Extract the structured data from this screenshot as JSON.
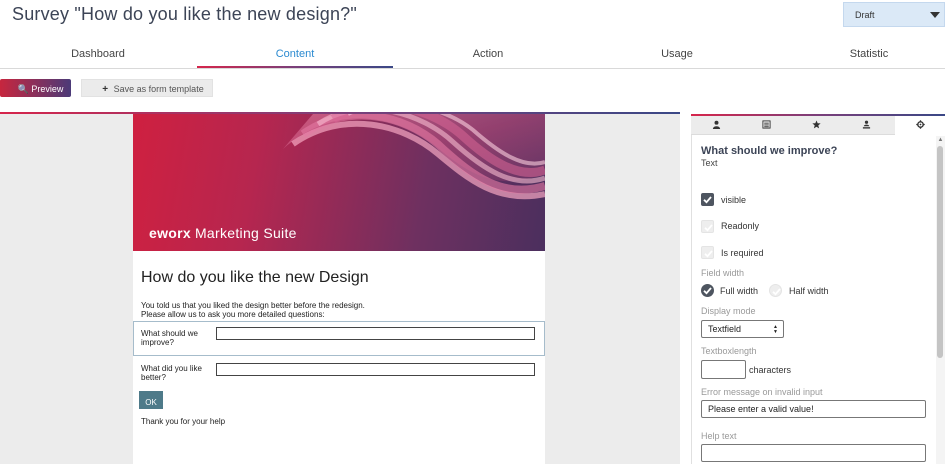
{
  "header": {
    "title": "Survey \"How do you like the new design?\"",
    "status": "Draft"
  },
  "tabs": [
    {
      "label": "Dashboard"
    },
    {
      "label": "Content"
    },
    {
      "label": "Action"
    },
    {
      "label": "Usage"
    },
    {
      "label": "Statistic"
    }
  ],
  "toolbar": {
    "preview_label": "Preview",
    "template_label": "Save as form template"
  },
  "form": {
    "brand_bold": "eworx",
    "brand_rest": "Marketing Suite",
    "heading": "How do you like the new Design",
    "intro_line1": "You told us that you liked the design better before the redesign.",
    "intro_line2": "Please allow us to ask you more detailed questions:",
    "questions": [
      {
        "label": "What should we improve?"
      },
      {
        "label": "What did you like better?"
      }
    ],
    "ok_label": "OK",
    "thanks": "Thank you for your help"
  },
  "panel": {
    "tabs": [
      {
        "icon": "person-icon"
      },
      {
        "icon": "list-icon"
      },
      {
        "icon": "star-icon"
      },
      {
        "icon": "user-download-icon"
      },
      {
        "icon": "gear-icon"
      }
    ],
    "field_title": "What should we improve?",
    "field_type": "Text",
    "visible_label": "visible",
    "readonly_label": "Readonly",
    "required_label": "Is required",
    "field_width_label": "Field width",
    "full_width_label": "Full width",
    "half_width_label": "Half width",
    "display_mode_label": "Display mode",
    "display_mode_value": "Textfield",
    "textboxlength_label": "Textboxlength",
    "textboxlength_value": "",
    "characters_label": "characters",
    "error_label": "Error message on invalid input",
    "error_value": "Please enter a valid value!",
    "help_label": "Help text",
    "help_value": ""
  },
  "colors": {
    "accent_blue": "#2b8ad0",
    "brand_red": "#d6254b",
    "brand_purple": "#3a4886",
    "ok_button": "#4e7a89"
  }
}
